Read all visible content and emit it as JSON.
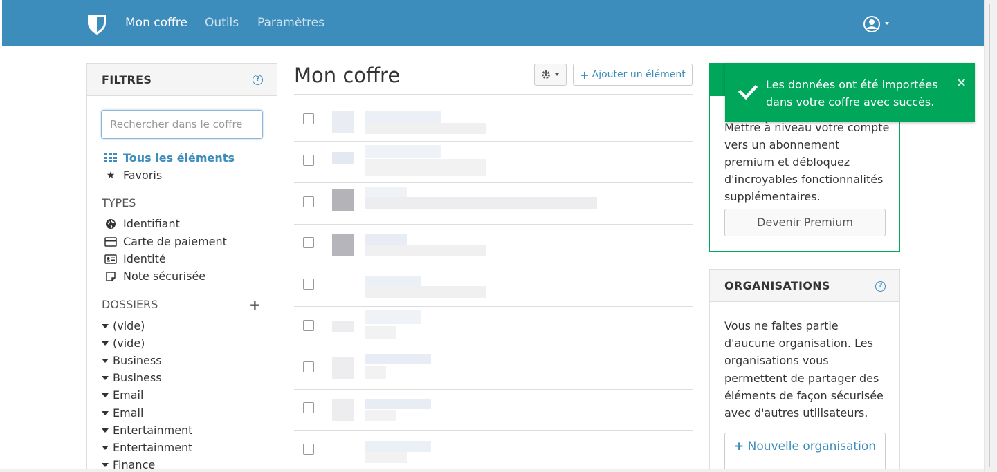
{
  "nav": {
    "brand_icon": "shield-icon",
    "links": [
      {
        "label": "Mon coffre",
        "active": true
      },
      {
        "label": "Outils",
        "active": false
      },
      {
        "label": "Paramètres",
        "active": false
      }
    ],
    "account_icon": "user-circle-icon"
  },
  "filters": {
    "title": "FILTRES",
    "help": "?",
    "search_placeholder": "Rechercher dans le coffre",
    "all_items": "Tous les éléments",
    "favorites": "Favoris",
    "types_label": "TYPES",
    "types": [
      "Identifiant",
      "Carte de paiement",
      "Identité",
      "Note sécurisée"
    ],
    "folders_label": "DOSSIERS",
    "add_folder": "+",
    "folders": [
      "(vide)",
      "(vide)",
      "Business",
      "Business",
      "Email",
      "Email",
      "Entertainment",
      "Entertainment",
      "Finance"
    ]
  },
  "main": {
    "title": "Mon coffre",
    "gear_icon": "gear-icon",
    "add_label": "Ajouter un élément",
    "row_count": 9
  },
  "premium": {
    "text": "Mettre à niveau votre compte vers un abonnement premium et débloquez d'incroyables fonctionnalités supplémentaires.",
    "button": "Devenir Premium"
  },
  "organizations": {
    "title": "ORGANISATIONS",
    "help": "?",
    "text": "Vous ne faites partie d'aucune organisation. Les organisations vous permettent de partager des éléments de façon sécurisée avec d'autres utilisateurs.",
    "button": "Nouvelle organisation"
  },
  "toast": {
    "message": "Les données ont été importées dans votre coffre avec succès.",
    "close": "×"
  },
  "colors": {
    "primary": "#3c8dbc",
    "success": "#00a65a"
  }
}
